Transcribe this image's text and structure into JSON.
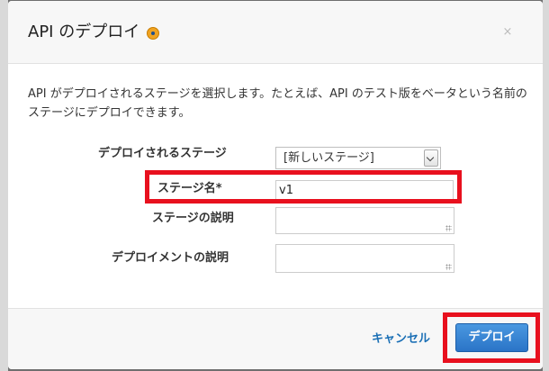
{
  "dialog": {
    "title": "API のデプロイ",
    "info_icon": "info-icon",
    "close_icon": "×",
    "description": "API がデプロイされるステージを選択します。たとえば、API のテスト版をベータという名前のステージにデプロイできます。"
  },
  "form": {
    "deploy_stage": {
      "label": "デプロイされるステージ",
      "value": "[新しいステージ]"
    },
    "stage_name": {
      "label": "ステージ名*",
      "value": "v1"
    },
    "stage_description": {
      "label": "ステージの説明",
      "value": ""
    },
    "deployment_description": {
      "label": "デプロイメントの説明",
      "value": ""
    }
  },
  "footer": {
    "cancel_label": "キャンセル",
    "deploy_label": "デプロイ"
  },
  "colors": {
    "highlight": "#e8101e",
    "primary_button": "#2a74c7",
    "link": "#1a6fb5",
    "info_icon": "#f0a321"
  }
}
